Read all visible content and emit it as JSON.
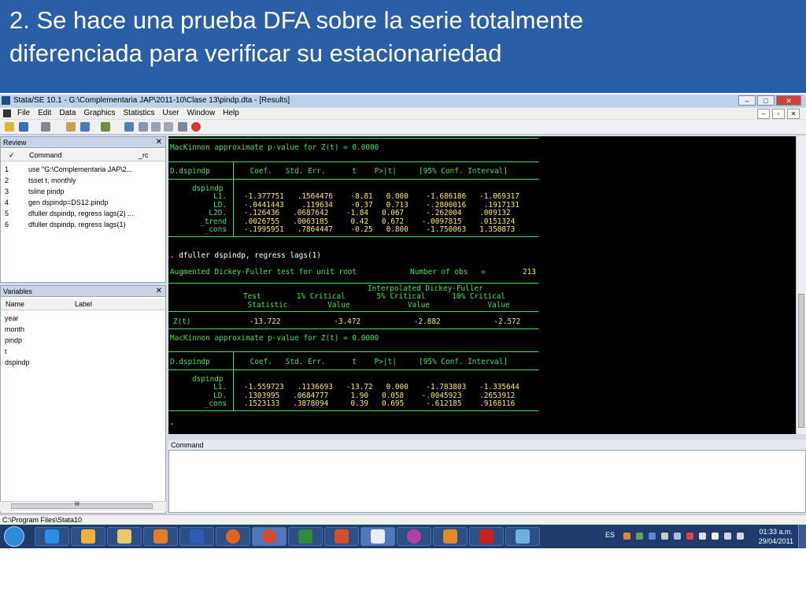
{
  "slide": {
    "title_line1": "2. Se hace una prueba DFA sobre la serie totalmente",
    "title_line2": "diferenciada para verificar su estacionariedad"
  },
  "window": {
    "title": "Stata/SE 10.1 - G:\\Complementaria JAP\\2011-10\\Clase 13\\pindp.dta - [Results]",
    "minimize": "–",
    "maximize": "□",
    "close": "✕"
  },
  "menubar": {
    "items": [
      "File",
      "Edit",
      "Data",
      "Graphics",
      "Statistics",
      "User",
      "Window",
      "Help"
    ],
    "mdi_min": "–",
    "mdi_restore": "▫",
    "mdi_close": "✕"
  },
  "review": {
    "title": "Review",
    "close": "✕",
    "col_num": "✓",
    "col_command": "Command",
    "col_rc": "_rc",
    "rows": [
      {
        "n": "1",
        "cmd": "use \"G:\\Complementaria JAP\\2..."
      },
      {
        "n": "2",
        "cmd": "tsset t, monthly"
      },
      {
        "n": "3",
        "cmd": "tsline pindp"
      },
      {
        "n": "4",
        "cmd": "gen dspindp=DS12.pindp"
      },
      {
        "n": "5",
        "cmd": "dfuller dspindp, regress lags(2) ..."
      },
      {
        "n": "6",
        "cmd": "dfuller dspindp, regress lags(1)"
      }
    ]
  },
  "variables": {
    "title": "Variables",
    "close": "✕",
    "col_name": "Name",
    "col_label": "Label",
    "items": [
      "year",
      "month",
      "pindp",
      "t",
      "dspindp"
    ],
    "scroll_grip": "III"
  },
  "results": {
    "mackinnon1": "MacKinnon approximate p-value for Z(t) = 0.0000",
    "reg1_header": "D.dspindp         Coef.   Std. Err.      t    P>|t|     [95% Conf. Interval]",
    "reg1_depvar": "dspindp",
    "reg1_labels": "L1.\nLD.\nL2D.\n_trend\n_cons",
    "reg1_values": "-1.377751   .1564476    -8.81   0.000    -1.686186   -1.069317\n-.0441443    .119634    -0.37   0.713    -.2800016    .1917131\n-.126436   .0687642    -1.84   0.067     -.262004    .009132\n.0026755   .0063185     0.42   0.672    -.0097815    .0151324\n-.1995951   .7864447    -0.25   0.800    -1.750063   1.350873",
    "command": ". dfuller dspindp, regress lags(1)",
    "adf_title": "Augmented Dickey-Fuller test for unit root",
    "nobs_label": "Number of obs   =",
    "nobs_value": "213",
    "interp_header": "Interpolated Dickey-Fuller",
    "crit_header": "Test        1% Critical       5% Critical      10% Critical\n Statistic         Value             Value             Value",
    "zt_label": "Z(t)",
    "zt_values": "-13.722            -3.472            -2.882            -2.572",
    "mackinnon2": "MacKinnon approximate p-value for Z(t) = 0.0000",
    "reg2_header": "D.dspindp         Coef.   Std. Err.      t    P>|t|     [95% Conf. Interval]",
    "reg2_depvar": "dspindp",
    "reg2_labels": "L1.\nLD.\n_cons",
    "reg2_values": "-1.559723   .1136693   -13.72   0.000    -1.783803   -1.335644\n.1303995   .0684777     1.90   0.058    -.0045923    .2653912\n.1523133   .3878094     0.39   0.695     -.612185    .9168116",
    "prompt": "."
  },
  "command_pane": {
    "title": "Command"
  },
  "status_bar": {
    "path": "C:\\Program Files\\Stata10"
  },
  "taskbar": {
    "language": "ES",
    "time": "01:33 a.m.",
    "date": "29/04/2011"
  }
}
